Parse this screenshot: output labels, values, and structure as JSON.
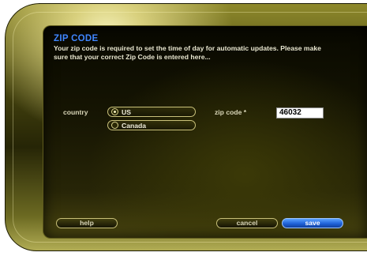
{
  "dialog": {
    "title": "ZIP CODE",
    "description": "Your zip code is required to set the time of day for automatic updates. Please make sure that your correct Zip Code is entered here..."
  },
  "form": {
    "country_label": "country",
    "country_options": [
      "US",
      "Canada"
    ],
    "selected_country": "US",
    "zip_label": "zip code *",
    "zip_value": "46032"
  },
  "buttons": {
    "help": "help",
    "cancel": "cancel",
    "save": "save"
  },
  "colors": {
    "title": "#3f86ff",
    "save_button": "#1f62d8"
  }
}
